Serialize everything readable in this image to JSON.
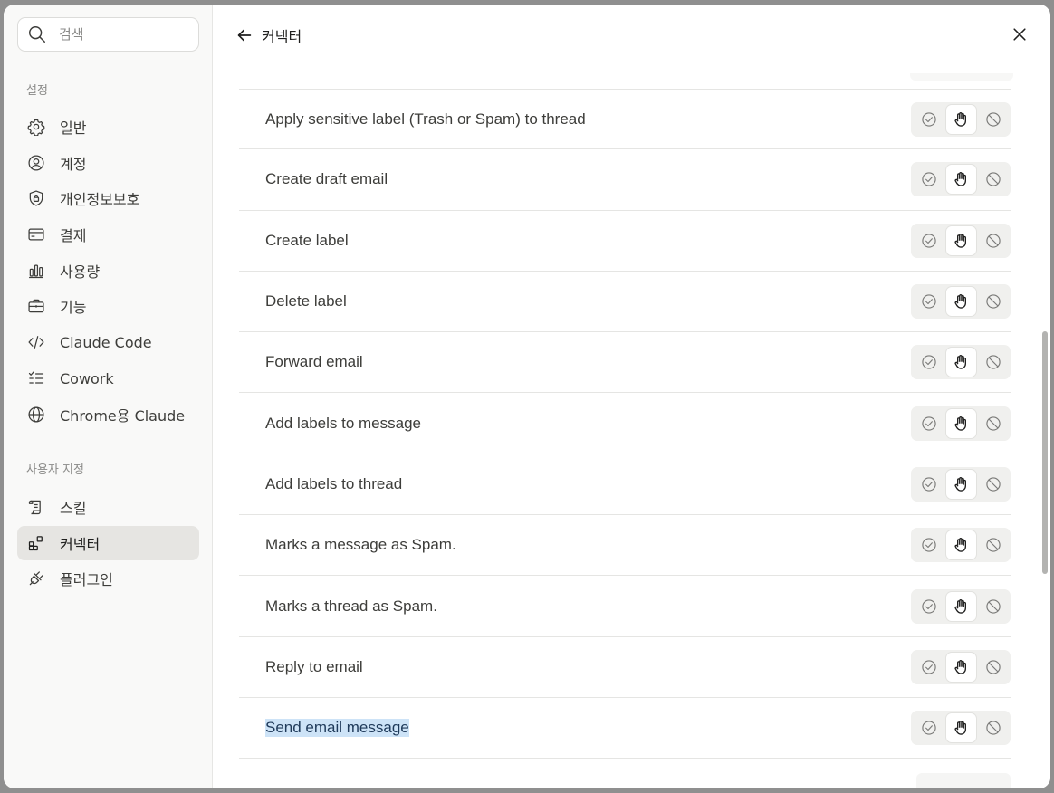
{
  "sidebar": {
    "search_placeholder": "검색",
    "section_settings": "설정",
    "settings_items": [
      {
        "label": "일반",
        "icon": "gear-icon"
      },
      {
        "label": "계정",
        "icon": "user-circle-icon"
      },
      {
        "label": "개인정보보호",
        "icon": "shield-lock-icon"
      },
      {
        "label": "결제",
        "icon": "credit-card-icon"
      },
      {
        "label": "사용량",
        "icon": "bar-chart-icon"
      },
      {
        "label": "기능",
        "icon": "briefcase-icon"
      },
      {
        "label": "Claude Code",
        "icon": "code-icon"
      },
      {
        "label": "Cowork",
        "icon": "checklist-icon"
      },
      {
        "label": "Chrome용 Claude",
        "icon": "globe-icon"
      }
    ],
    "section_custom": "사용자 지정",
    "custom_items": [
      {
        "label": "스킬",
        "icon": "scroll-icon"
      },
      {
        "label": "커넥터",
        "icon": "connector-blocks-icon",
        "active": true
      },
      {
        "label": "플러그인",
        "icon": "plug-icon"
      }
    ]
  },
  "header": {
    "title": "커넥터"
  },
  "tools": [
    {
      "label": "Apply sensitive label (Trash or Spam) to thread",
      "state": "ask"
    },
    {
      "label": "Create draft email",
      "state": "ask"
    },
    {
      "label": "Create label",
      "state": "ask"
    },
    {
      "label": "Delete label",
      "state": "ask"
    },
    {
      "label": "Forward email",
      "state": "ask"
    },
    {
      "label": "Add labels to message",
      "state": "ask"
    },
    {
      "label": "Add labels to thread",
      "state": "ask"
    },
    {
      "label": "Marks a message as Spam.",
      "state": "ask"
    },
    {
      "label": "Marks a thread as Spam.",
      "state": "ask"
    },
    {
      "label": "Reply to email",
      "state": "ask"
    },
    {
      "label": "Send email message",
      "state": "ask",
      "selected": true
    }
  ],
  "permission_icons": [
    "check-circle-icon",
    "hand-icon",
    "block-icon"
  ],
  "colors": {
    "active_nav_bg": "#e6e5e2",
    "selection_highlight": "#cde3f7"
  }
}
